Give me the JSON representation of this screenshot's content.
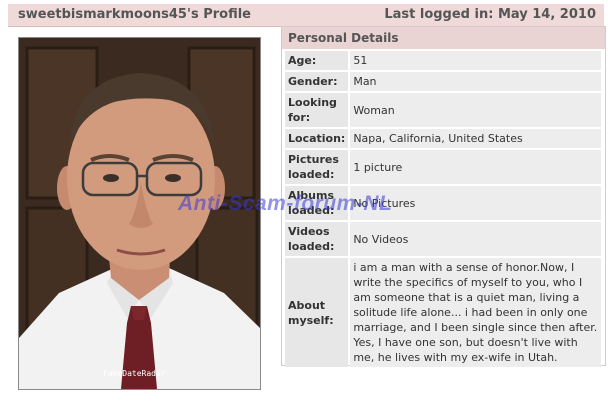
{
  "header": {
    "profile_name": "sweetbismarkmoons45's Profile",
    "last_logged_in": "Last logged in:  May 14, 2010"
  },
  "photo": {
    "caption": "FakeDateRadar"
  },
  "details": {
    "title": "Personal Details",
    "rows": [
      {
        "label": "Age:",
        "value": "51"
      },
      {
        "label": "Gender:",
        "value": "Man"
      },
      {
        "label": "Looking for:",
        "value": "Woman"
      },
      {
        "label": "Location:",
        "value": "Napa,  California,  United States"
      },
      {
        "label": "Pictures loaded:",
        "value": "1 picture"
      },
      {
        "label": "Albums loaded:",
        "value": "No Pictures"
      },
      {
        "label": "Videos loaded:",
        "value": "No Videos"
      },
      {
        "label": "About myself:",
        "value": "i am a man with a sense of honor.Now, I write the specifics of myself to you, who I am someone that is a quiet man, living a solitude life alone... i had been in only one marriage, and I been single since then after. Yes, I have one son, but doesn't live with me, he lives with my ex-wife in Utah."
      }
    ]
  },
  "watermark": "Anti-Scam-forum-NL"
}
